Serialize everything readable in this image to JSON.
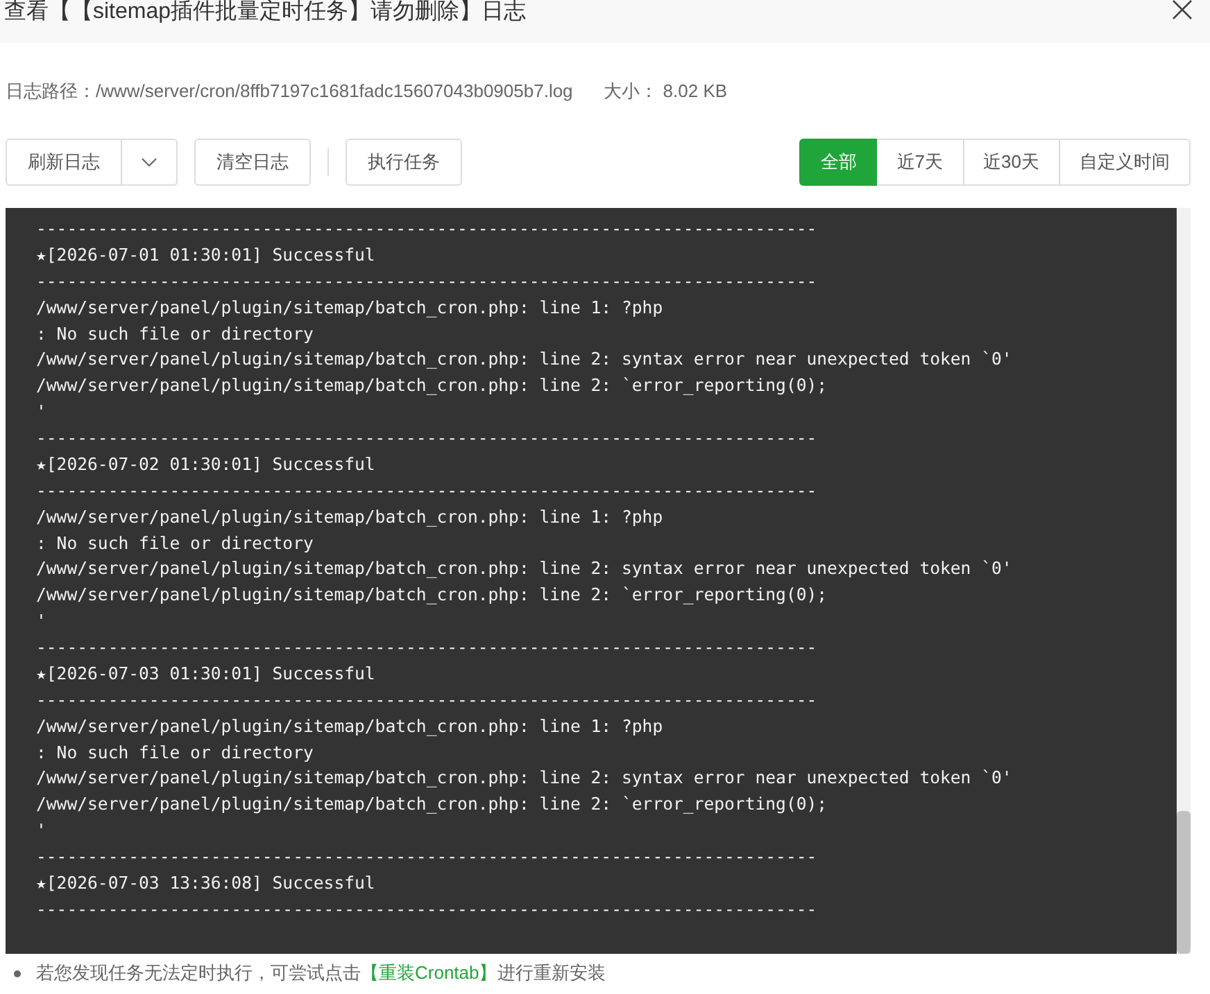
{
  "window": {
    "title": "查看【【sitemap插件批量定时任务】请勿删除】日志"
  },
  "info": {
    "path": "日志路径：/www/server/cron/8ffb7197c1681fadc15607043b0905b7.log",
    "size_label": "大小：",
    "size_value": "8.02 KB"
  },
  "actions": [
    {
      "kind": "split",
      "label": "刷新日志"
    },
    {
      "kind": "plain",
      "label": "清空日志"
    },
    {
      "kind": "divider"
    },
    {
      "kind": "plain",
      "label": "执行任务"
    }
  ],
  "filters": [
    {
      "label": "全部",
      "selected": true
    },
    {
      "label": "近7天",
      "selected": false
    },
    {
      "label": "近30天",
      "selected": false
    },
    {
      "label": "自定义时间",
      "selected": false
    }
  ],
  "log": {
    "lines": [
      "----------------------------------------------------------------------------",
      "★[2026-07-01 01:30:01] Successful",
      "----------------------------------------------------------------------------",
      "/www/server/panel/plugin/sitemap/batch_cron.php: line 1: ?php",
      ": No such file or directory",
      "/www/server/panel/plugin/sitemap/batch_cron.php: line 2: syntax error near unexpected token `0'",
      "/www/server/panel/plugin/sitemap/batch_cron.php: line 2: `error_reporting(0);",
      "'",
      "----------------------------------------------------------------------------",
      "★[2026-07-02 01:30:01] Successful",
      "----------------------------------------------------------------------------",
      "/www/server/panel/plugin/sitemap/batch_cron.php: line 1: ?php",
      ": No such file or directory",
      "/www/server/panel/plugin/sitemap/batch_cron.php: line 2: syntax error near unexpected token `0'",
      "/www/server/panel/plugin/sitemap/batch_cron.php: line 2: `error_reporting(0);",
      "'",
      "----------------------------------------------------------------------------",
      "★[2026-07-03 01:30:01] Successful",
      "----------------------------------------------------------------------------",
      "/www/server/panel/plugin/sitemap/batch_cron.php: line 1: ?php",
      ": No such file or directory",
      "/www/server/panel/plugin/sitemap/batch_cron.php: line 2: syntax error near unexpected token `0'",
      "/www/server/panel/plugin/sitemap/batch_cron.php: line 2: `error_reporting(0);",
      "'",
      "----------------------------------------------------------------------------",
      "★[2026-07-03 13:36:08] Successful",
      "----------------------------------------------------------------------------"
    ]
  },
  "hint": {
    "text_before": "若您发现任务无法定时执行，可尝试点击",
    "link": "【重装Crontab】",
    "text_after": "进行重新安装"
  }
}
